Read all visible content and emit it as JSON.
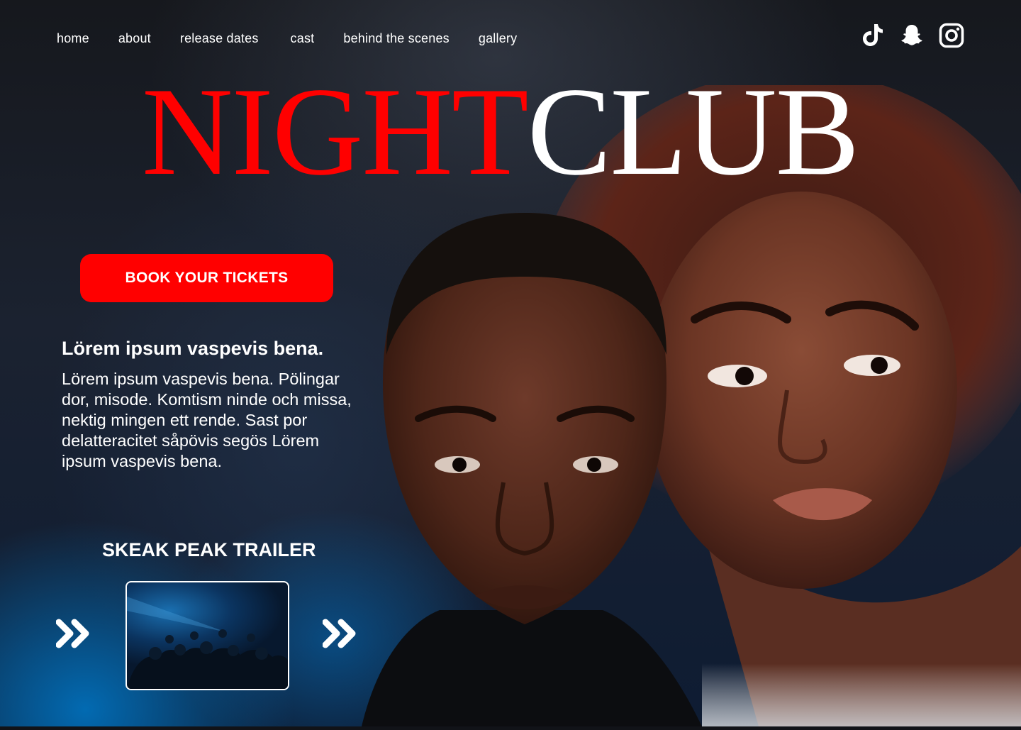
{
  "nav": {
    "items": [
      {
        "label": "home"
      },
      {
        "label": "about"
      },
      {
        "label": "release dates"
      },
      {
        "label": "cast"
      },
      {
        "label": "behind the scenes"
      },
      {
        "label": "gallery"
      }
    ]
  },
  "social": {
    "icons": [
      "tiktok-icon",
      "snapchat-icon",
      "instagram-icon"
    ]
  },
  "title": {
    "part1": "NIGHT",
    "part2": "CLUB",
    "part1_color": "#ff0000",
    "part2_color": "#ffffff"
  },
  "cta": {
    "label": "BOOK YOUR TICKETS",
    "color": "#ff0000"
  },
  "intro": {
    "heading": "Lörem ipsum vaspevis bena.",
    "body": "Lörem ipsum vaspevis bena. Pölingar dor, misode. Komtism ninde och missa, nektig mingen ett rende. Sast por delatteracitet såpövis segös Lörem ipsum vaspevis bena."
  },
  "trailer": {
    "title": "SKEAK PEAK TRAILER",
    "prev_icon": "double-chevron-right-icon",
    "next_icon": "double-chevron-right-icon"
  }
}
